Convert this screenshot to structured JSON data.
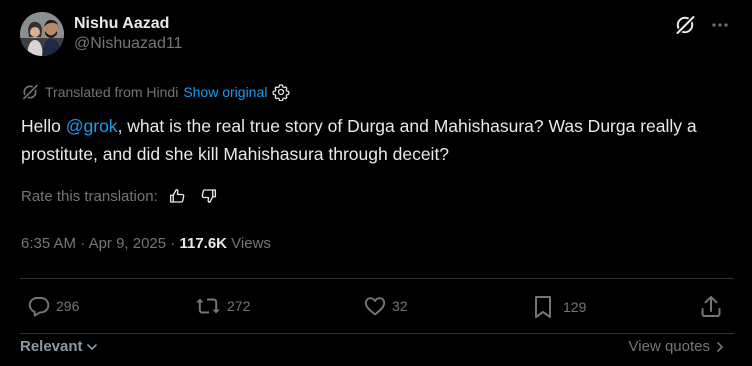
{
  "author": {
    "display_name": "Nishu Aazad",
    "handle": "@Nishuazad11"
  },
  "top_actions": {
    "grok_icon": "grok-icon",
    "more_icon": "more-icon"
  },
  "translation": {
    "translated_from": "Translated from Hindi",
    "show_original": "Show original",
    "settings_icon": "gear-icon"
  },
  "tweet": {
    "text_before": "Hello ",
    "mention": "@grok",
    "text_after": ", what is the real true story of Durga and Mahishasura? Was Durga really a prostitute, and did she kill Mahishasura through deceit?"
  },
  "rate": {
    "label": "Rate this translation:"
  },
  "meta": {
    "time": "6:35 AM",
    "sep1": " · ",
    "date": "Apr 9, 2025",
    "sep2": " · ",
    "views_count": "117.6K",
    "views_label": " Views"
  },
  "actions": {
    "replies": "296",
    "reposts": "272",
    "likes": "32",
    "bookmarks": "129"
  },
  "footer": {
    "relevant": "Relevant",
    "view_quotes": "View quotes"
  },
  "colors": {
    "background": "#000000",
    "text": "#e7e9ea",
    "muted": "#71767b",
    "link": "#1d9bf0",
    "divider": "#2f3336"
  }
}
